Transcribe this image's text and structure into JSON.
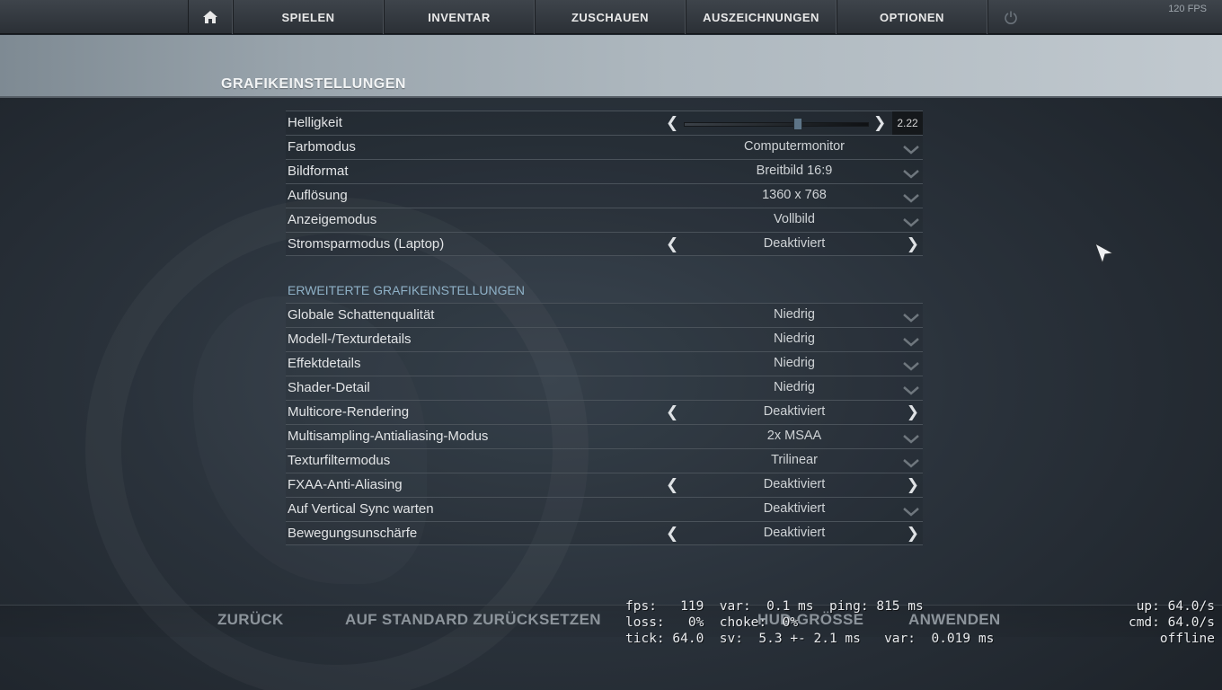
{
  "fps_counter": "120 FPS",
  "nav": {
    "items": [
      "SPIELEN",
      "INVENTAR",
      "ZUSCHAUEN",
      "AUSZEICHNUNGEN",
      "OPTIONEN"
    ],
    "home_icon": "home-icon",
    "power_icon": "power-icon"
  },
  "page_title": "GRAFIKEINSTELLUNGEN",
  "brightness": {
    "label": "Helligkeit",
    "value": "2.22",
    "level": 0.62
  },
  "settings": {
    "farbmodus": {
      "label": "Farbmodus",
      "value": "Computermonitor"
    },
    "bildformat": {
      "label": "Bildformat",
      "value": "Breitbild 16:9"
    },
    "aufloesung": {
      "label": "Auflösung",
      "value": "1360 x 768"
    },
    "anzeigemodus": {
      "label": "Anzeigemodus",
      "value": "Vollbild"
    },
    "stromspar": {
      "label": "Stromsparmodus (Laptop)",
      "value": "Deaktiviert"
    }
  },
  "advanced_title": "ERWEITERTE GRAFIKEINSTELLUNGEN",
  "advanced": {
    "schatten": {
      "label": "Globale Schattenqualität",
      "value": "Niedrig"
    },
    "modell": {
      "label": "Modell-/Texturdetails",
      "value": "Niedrig"
    },
    "effekt": {
      "label": "Effektdetails",
      "value": "Niedrig"
    },
    "shader": {
      "label": "Shader-Detail",
      "value": "Niedrig"
    },
    "multicore": {
      "label": "Multicore-Rendering",
      "value": "Deaktiviert"
    },
    "msaa": {
      "label": "Multisampling-Antialiasing-Modus",
      "value": "2x MSAA"
    },
    "texturfilter": {
      "label": "Texturfiltermodus",
      "value": "Trilinear"
    },
    "fxaa": {
      "label": "FXAA-Anti-Aliasing",
      "value": "Deaktiviert"
    },
    "vsync": {
      "label": "Auf Vertical Sync warten",
      "value": "Deaktiviert"
    },
    "blur": {
      "label": "Bewegungsunschärfe",
      "value": "Deaktiviert"
    }
  },
  "bottom": {
    "back": "ZURÜCK",
    "reset": "AUF STANDARD ZURÜCKSETZEN",
    "hud": "HUD-GRÖSSE",
    "apply": "ANWENDEN"
  },
  "netgraph": {
    "line1": "fps:   119  var:  0.1 ms  ping: 815 ms",
    "line2": "loss:   0%  choke:  0%",
    "line3": "tick: 64.0  sv:  5.3 +- 2.1 ms   var:  0.019 ms",
    "right1": "up: 64.0/s",
    "right2": "cmd: 64.0/s",
    "right3": "offline"
  },
  "colors": {
    "accent_blue": "#8fb1c7",
    "slider_thumb": "#5d7487"
  }
}
